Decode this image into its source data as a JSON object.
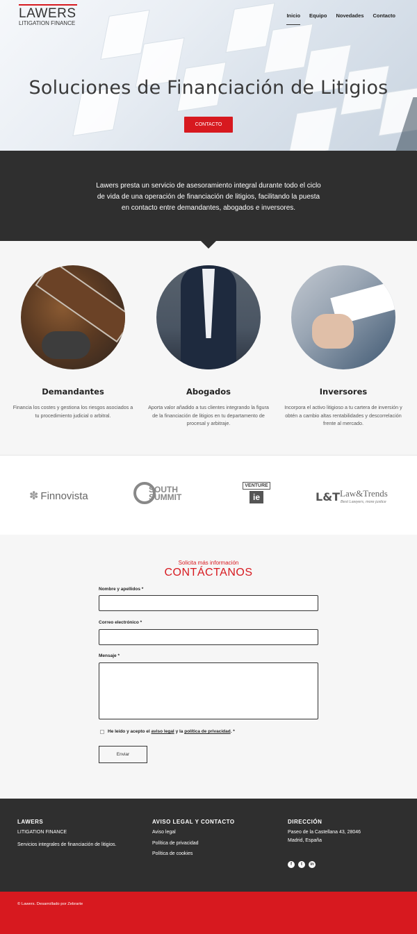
{
  "brand": {
    "name": "LAWERS",
    "subtitle": "LITIGATION FINANCE"
  },
  "nav": {
    "items": [
      "Inicio",
      "Equipo",
      "Novedades",
      "Contacto"
    ],
    "active": "Inicio"
  },
  "hero": {
    "title": "Soluciones de Financiación de Litigios",
    "cta_label": "CONTACTO"
  },
  "intro": {
    "text": "Lawers presta un servicio de asesoramiento integral durante todo el ciclo de vida de una operación de financiación de litigios, facilitando la puesta en contacto entre demandantes, abogados e inversores."
  },
  "services": [
    {
      "title": "Demandantes",
      "text": "Financia los costes y gestiona los riesgos asociados a tu procedimiento judicial o arbitral."
    },
    {
      "title": "Abogados",
      "text": "Aporta valor añadido a tus clientes integrando la figura de la financiación de litigios en tu departamento de procesal y arbitraje."
    },
    {
      "title": "Inversores",
      "text": "Incorpora el activo litigioso a tu cartera de inversión y obtén a cambio altas rentabilidades y descorrelación frente al mercado."
    }
  ],
  "partners": {
    "finnovista": "Finnovista",
    "south_summit": "SOUTH SUMMIT",
    "venture": "VENTURE",
    "ie": "ie",
    "lt_mark": "L&T",
    "lt_name": "Law&Trends",
    "lt_tag": "Best Lawyers, more justice"
  },
  "contact": {
    "subtitle": "Solicita más información",
    "title": "CONTÁCTANOS",
    "name_label": "Nombre y apellidos *",
    "email_label": "Correo electrónico *",
    "message_label": "Mensaje *",
    "name_value": "",
    "email_value": "",
    "message_value": "",
    "consent_prefix": "He leído y acepto el",
    "consent_legal": "aviso legal",
    "consent_and": "y la",
    "consent_privacy": "política de privacidad",
    "consent_suffix": ". *",
    "send_label": "Enviar"
  },
  "footer": {
    "col1_title": "LAWERS",
    "col1_line1": "LITIGATION FINANCE",
    "col1_line2": "Servicios integrales de financiación de litigios.",
    "col2_title": "AVISO LEGAL Y CONTACTO",
    "col2_links": [
      "Aviso legal",
      "Política de privacidad",
      "Política de cookies"
    ],
    "col3_title": "DIRECCIÓN",
    "col3_line1": "Paseo de la Castellana 43, 28046",
    "col3_line2": "Madrid, España",
    "social_icons": [
      "facebook-icon",
      "twitter-icon",
      "linkedin-icon"
    ],
    "social_glyphs": [
      "f",
      "t",
      "in"
    ],
    "copyright": "© Lawers. Desarrollado por Zebrarte"
  },
  "colors": {
    "accent": "#d7191f",
    "dark": "#2f2f2f",
    "light_bg": "#f6f6f6"
  }
}
